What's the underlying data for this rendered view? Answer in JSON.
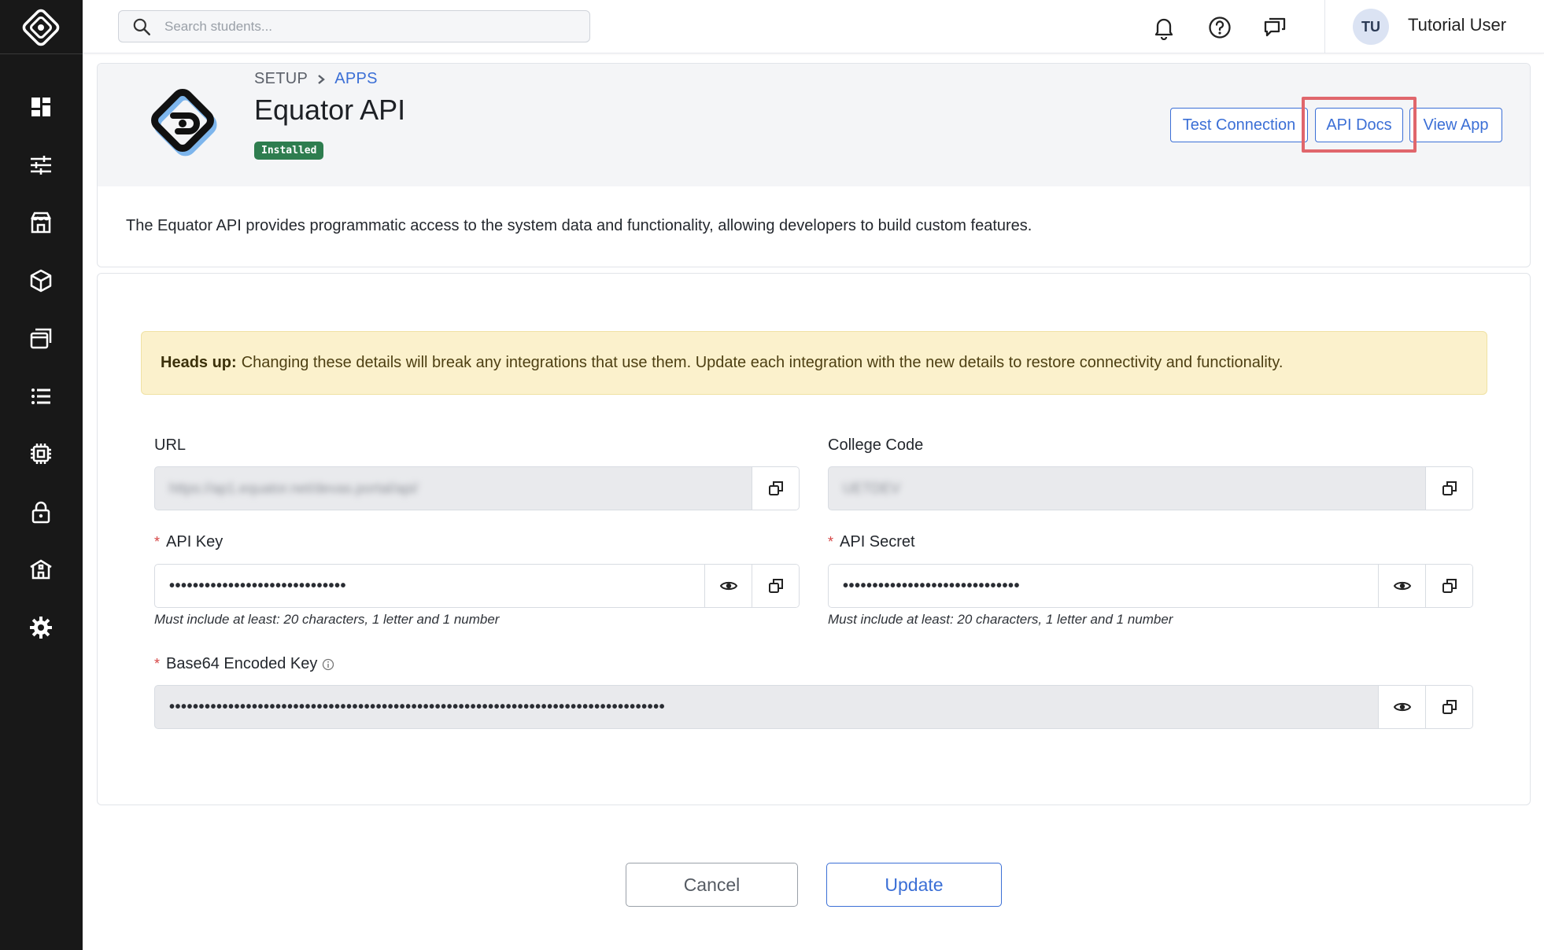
{
  "sidebar": {
    "logo_icon": "equator-logo-icon",
    "items": [
      {
        "name": "dashboard",
        "icon": "grid-icon"
      },
      {
        "name": "controls",
        "icon": "sliders-icon"
      },
      {
        "name": "store",
        "icon": "store-icon"
      },
      {
        "name": "products",
        "icon": "cube-icon"
      },
      {
        "name": "windows",
        "icon": "layers-icon"
      },
      {
        "name": "list",
        "icon": "list-icon"
      },
      {
        "name": "chip",
        "icon": "chip-icon"
      },
      {
        "name": "security",
        "icon": "lock-icon"
      },
      {
        "name": "campus",
        "icon": "building-icon"
      },
      {
        "name": "settings",
        "icon": "gear-icon"
      }
    ]
  },
  "topbar": {
    "search_placeholder": "Search students...",
    "icons": [
      "bell-icon",
      "help-icon",
      "chat-icon"
    ],
    "user": {
      "initials": "TU",
      "name": "Tutorial User"
    }
  },
  "app": {
    "breadcrumb": [
      "SETUP",
      "APPS"
    ],
    "title": "Equator API",
    "badge": "Installed",
    "buttons": {
      "test_connection": "Test Connection",
      "api_docs": "API Docs",
      "view_app": "View App"
    },
    "description": "The Equator API provides programmatic access to the system data and functionality, allowing developers to build custom features."
  },
  "form": {
    "alert": {
      "title": "Heads up:",
      "text": "Changing these details will break any integrations that use them. Update each integration with the new details to restore connectivity and functionality."
    },
    "url": {
      "label": "URL",
      "value": "https://ap1.equator.net/devas.portal/api/"
    },
    "college_code": {
      "label": "College Code",
      "value": "UETDEV"
    },
    "api_key": {
      "label": "API Key",
      "value": "••••••••••••••••••••••••••••••",
      "hint": "Must include at least: 20 characters, 1 letter and 1 number"
    },
    "api_secret": {
      "label": "API Secret",
      "value": "••••••••••••••••••••••••••••••",
      "hint": "Must include at least: 20 characters, 1 letter and 1 number"
    },
    "base64": {
      "label": "Base64 Encoded Key",
      "value": "••••••••••••••••••••••••••••••••••••••••••••••••••••••••••••••••••••••••••••••••••••"
    }
  },
  "footer": {
    "cancel": "Cancel",
    "update": "Update"
  },
  "colors": {
    "accent": "#3b6fd6",
    "sidebar": "#181818",
    "badge": "#2e7d4f",
    "alert_bg": "#fbf1cc",
    "highlight": "#e0666c"
  }
}
